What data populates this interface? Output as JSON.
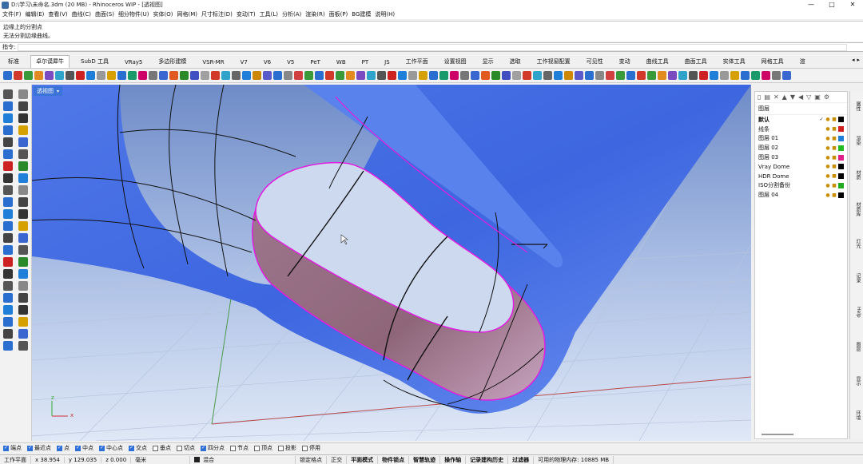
{
  "window": {
    "title": "D:\\学习\\未命名.3dm (20 MB) - Rhinoceros WIP - [透视图]",
    "min": "—",
    "max": "□",
    "close": "✕"
  },
  "menu": [
    "文件(F)",
    "编辑(E)",
    "查看(V)",
    "曲线(C)",
    "曲面(S)",
    "细分物件(U)",
    "实体(O)",
    "网格(M)",
    "尺寸标注(D)",
    "变动(T)",
    "工具(L)",
    "分析(A)",
    "渲染(R)",
    "面板(P)",
    "BG建模",
    "说明(H)"
  ],
  "command_history": [
    "边缘上的分割点",
    "无法分割边缘曲线。"
  ],
  "command_prompt": "指令:",
  "tabs": [
    "标准",
    "卓尔谟犀牛",
    "SubD 工具",
    "VRay5",
    "多边形建模",
    "VSR-MR",
    "V7",
    "V6",
    "V5",
    "PeT",
    "WB",
    "PT",
    "JS",
    "工作平面",
    "设置视图",
    "显示",
    "选取",
    "工作视窗配置",
    "可见性",
    "变动",
    "曲线工具",
    "曲面工具",
    "实体工具",
    "网格工具",
    "渲"
  ],
  "active_tab": "卓尔谟犀牛",
  "viewport": {
    "label": "透视图",
    "caret": "▾",
    "axis_z": "z",
    "axis_x": "x"
  },
  "layers": {
    "header": "图层",
    "rows": [
      {
        "name": "默认",
        "check": "✓",
        "color": "#000000"
      },
      {
        "name": "线条",
        "check": "",
        "color": "#d02020"
      },
      {
        "name": "图层 01",
        "check": "",
        "color": "#1f7fd8"
      },
      {
        "name": "图层 02",
        "check": "",
        "color": "#22bb22"
      },
      {
        "name": "图层 03",
        "check": "",
        "color": "#e0208a"
      },
      {
        "name": "Vray Dome",
        "check": "",
        "color": "#000000"
      },
      {
        "name": "HDR Dome",
        "check": "",
        "color": "#000000"
      },
      {
        "name": "ISO分割备份",
        "check": "",
        "color": "#22aa22"
      },
      {
        "name": "图层 04",
        "check": "",
        "color": "#000000"
      }
    ]
  },
  "side_tabs": [
    "属性",
    "渲染",
    "材质",
    "材质库",
    "灯光",
    "记录",
    "Help",
    "图层",
    "显示",
    "环境"
  ],
  "osnap": [
    {
      "label": "端点",
      "on": true
    },
    {
      "label": "最近点",
      "on": true
    },
    {
      "label": "点",
      "on": true
    },
    {
      "label": "中点",
      "on": true
    },
    {
      "label": "中心点",
      "on": true
    },
    {
      "label": "交点",
      "on": true
    },
    {
      "label": "垂点",
      "on": false
    },
    {
      "label": "切点",
      "on": false
    },
    {
      "label": "四分点",
      "on": true
    },
    {
      "label": "节点",
      "on": false
    },
    {
      "label": "顶点",
      "on": false
    },
    {
      "label": "投影",
      "on": false
    },
    {
      "label": "停用",
      "on": false
    }
  ],
  "status": {
    "cplane": "工作平面",
    "x": "x 38.954",
    "y": "y 129.035",
    "z": "z 0.000",
    "unit": "毫米",
    "layer": "混合",
    "toggles": [
      "锁定格点",
      "正交",
      "平面模式",
      "物件锁点",
      "智慧轨迹",
      "操作轴",
      "记录建构历史",
      "过滤器"
    ],
    "memory": "可用的物理内存: 10885 MB"
  }
}
